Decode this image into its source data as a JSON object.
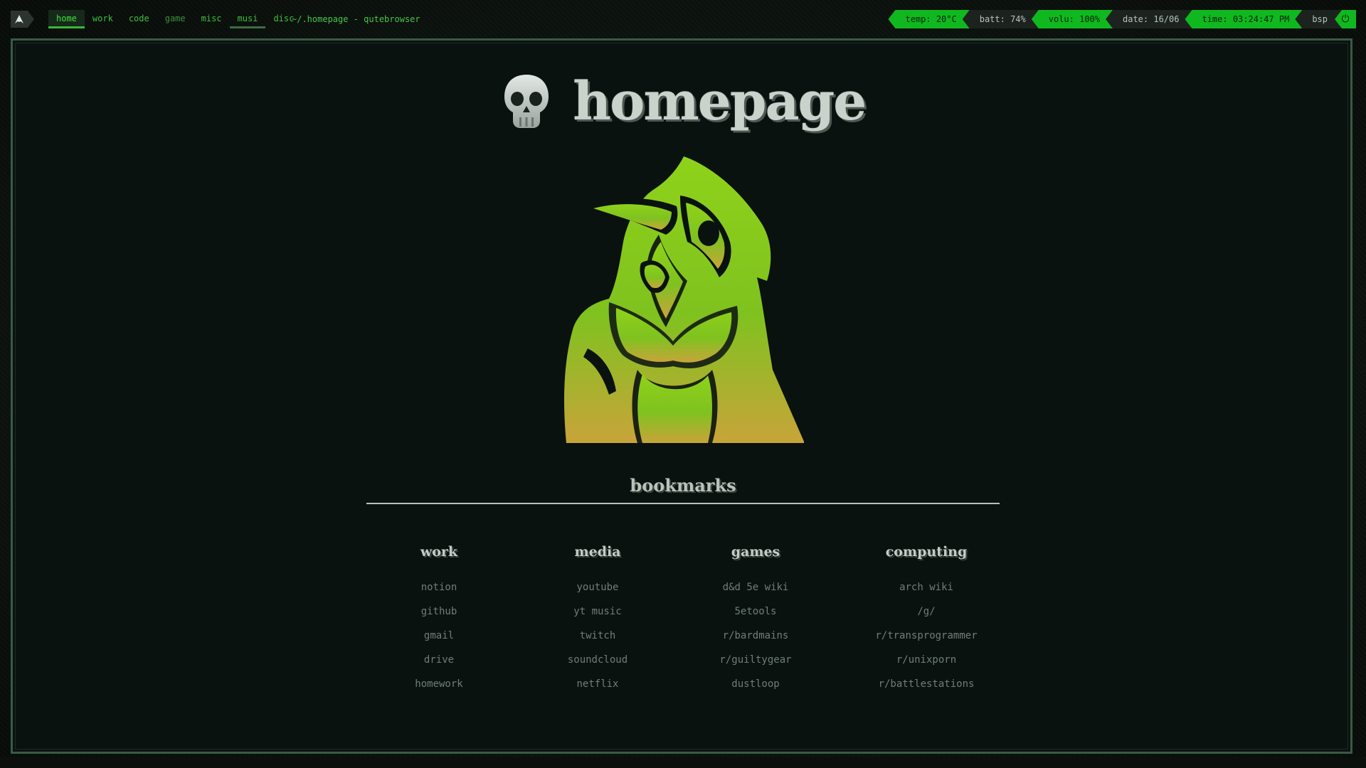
{
  "topbar": {
    "launcher_icon": "arch-launcher-icon",
    "workspaces": [
      "home",
      "work",
      "code",
      "game",
      "misc",
      "musi",
      "disc"
    ],
    "active_workspace": "home",
    "window_title": "~/.homepage - qutebrowser"
  },
  "status": {
    "temp": "temp: 20°C",
    "batt": "batt: 74%",
    "volu": "volu: 100%",
    "date": "date: 16/06",
    "time": "time: 03:24:47 PM",
    "layout": "bsp",
    "power_icon": "power-icon"
  },
  "page": {
    "title": "homepage",
    "title_icon": "skull-icon",
    "mascot_icon": "plague-doctor-illustration",
    "bookmarks_heading": "bookmarks",
    "columns": [
      {
        "title": "work",
        "links": [
          "notion",
          "github",
          "gmail",
          "drive",
          "homework"
        ]
      },
      {
        "title": "media",
        "links": [
          "youtube",
          "yt music",
          "twitch",
          "soundcloud",
          "netflix"
        ]
      },
      {
        "title": "games",
        "links": [
          "d&d 5e wiki",
          "5etools",
          "r/bardmains",
          "r/guiltygear",
          "dustloop"
        ]
      },
      {
        "title": "computing",
        "links": [
          "arch wiki",
          "/g/",
          "r/transprogrammer",
          "r/unixporn",
          "r/battlestations"
        ]
      }
    ]
  },
  "colors": {
    "accent_green": "#10b81f",
    "frame_border": "#3a5a45",
    "mascot_top": "#8fd21a",
    "mascot_bottom": "#c8a43a"
  }
}
